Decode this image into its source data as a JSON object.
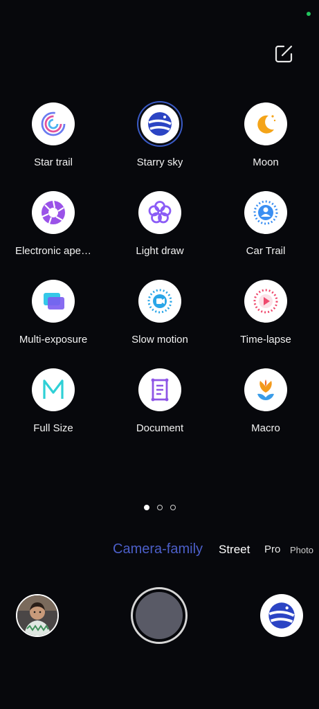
{
  "modes": [
    {
      "label": "Star trail",
      "icon": "star-trail-icon"
    },
    {
      "label": "Starry sky",
      "icon": "starry-sky-icon",
      "selected": true
    },
    {
      "label": "Moon",
      "icon": "moon-icon"
    },
    {
      "label": "Electronic ape…",
      "icon": "aperture-icon"
    },
    {
      "label": "Light draw",
      "icon": "light-draw-icon"
    },
    {
      "label": "Car Trail",
      "icon": "car-trail-icon"
    },
    {
      "label": "Multi-exposure",
      "icon": "multi-exposure-icon"
    },
    {
      "label": "Slow motion",
      "icon": "slow-motion-icon"
    },
    {
      "label": "Time-lapse",
      "icon": "time-lapse-icon"
    },
    {
      "label": "Full Size",
      "icon": "full-size-icon"
    },
    {
      "label": "Document",
      "icon": "document-icon"
    },
    {
      "label": "Macro",
      "icon": "macro-icon"
    }
  ],
  "pager": {
    "count": 3,
    "active": 0
  },
  "camera_modes": {
    "camera_family": "Camera-family",
    "street": "Street",
    "pro": "Pro",
    "photo": "Photo"
  },
  "colors": {
    "background": "#07080c",
    "active_mode": "#4c5fc9",
    "status_dot": "#22c55e"
  }
}
